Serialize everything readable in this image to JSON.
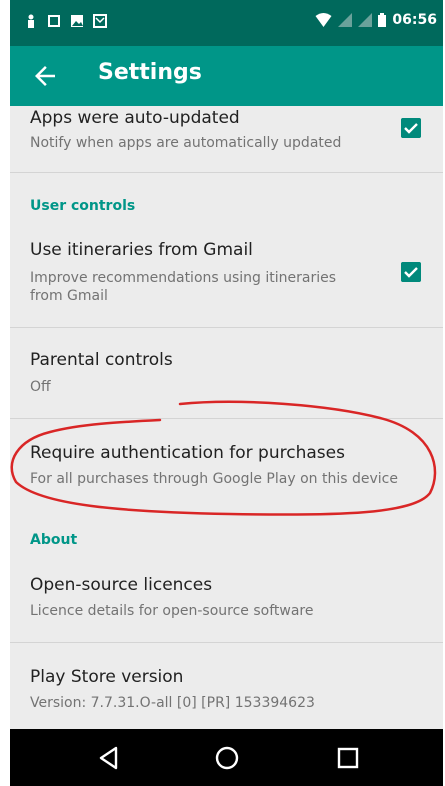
{
  "status_bar": {
    "time": "06:56"
  },
  "toolbar": {
    "title": "Settings",
    "back_icon": "arrow-back-icon"
  },
  "items": {
    "auto_update": {
      "title": "Apps were auto-updated",
      "summary": "Notify when apps are automatically updated",
      "checked": true
    },
    "itineraries": {
      "title": "Use itineraries from Gmail",
      "summary_line1": "Improve recommendations using itineraries",
      "summary_line2": "from Gmail",
      "checked": true
    },
    "parental": {
      "title": "Parental controls",
      "summary": "Off"
    },
    "auth": {
      "title": "Require authentication for purchases",
      "summary": "For all purchases through Google Play on this device"
    },
    "licences": {
      "title": "Open-source licences",
      "summary": "Licence details for open-source software"
    },
    "version": {
      "title": "Play Store version",
      "summary": "Version: 7.7.31.O-all [0] [PR] 153394623"
    }
  },
  "sections": {
    "user_controls": "User controls",
    "about": "About"
  },
  "colors": {
    "primary": "#009688",
    "primary_dark": "#00695c",
    "accent": "#00897b",
    "annotation": "#d92626"
  }
}
